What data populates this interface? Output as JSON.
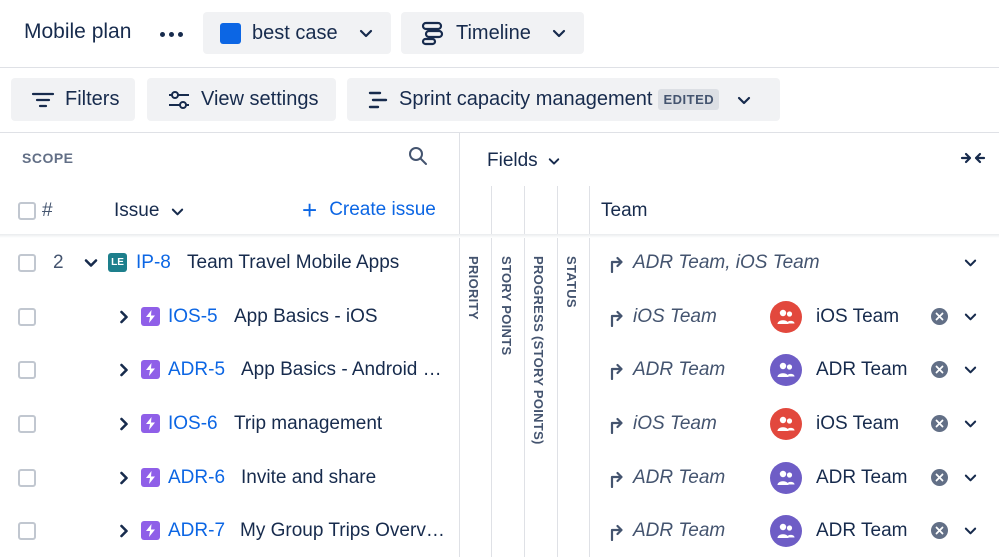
{
  "header": {
    "plan_title": "Mobile plan",
    "scenario": {
      "label": "best case",
      "color": "#0c66e4"
    },
    "view": {
      "label": "Timeline"
    }
  },
  "toolbar": {
    "filters_label": "Filters",
    "view_settings_label": "View settings",
    "capacity_label": "Sprint capacity management",
    "capacity_badge": "EDITED"
  },
  "scope": {
    "title": "SCOPE",
    "columns": {
      "hash": "#",
      "issue": "Issue",
      "create": "Create issue"
    }
  },
  "fields": {
    "label": "Fields",
    "columns": [
      "PRIORITY",
      "STORY POINTS",
      "PROGRESS (STORY POINTS)",
      "STATUS"
    ],
    "team_header": "Team"
  },
  "colors": {
    "ios_team": "#e2483d",
    "adr_team": "#6e5dc6",
    "epic": "#1d7f8c",
    "story": "#8f5fe8",
    "link": "#0c66e4"
  },
  "rows": [
    {
      "rank": "2",
      "icon_text": "LE",
      "type": "epic",
      "key": "IP-8",
      "title": "Team Travel Mobile Apps",
      "rollup": "ADR Team, iOS Team",
      "team": ""
    },
    {
      "rank": "",
      "icon_text": "",
      "type": "story",
      "key": "IOS-5",
      "title": "App Basics - iOS",
      "rollup": "iOS Team",
      "team": "iOS Team"
    },
    {
      "rank": "",
      "icon_text": "",
      "type": "story",
      "key": "ADR-5",
      "title": "App Basics - Android …",
      "rollup": "ADR Team",
      "team": "ADR Team"
    },
    {
      "rank": "",
      "icon_text": "",
      "type": "story",
      "key": "IOS-6",
      "title": "Trip management",
      "rollup": "iOS Team",
      "team": "iOS Team"
    },
    {
      "rank": "",
      "icon_text": "",
      "type": "story",
      "key": "ADR-6",
      "title": "Invite and share",
      "rollup": "ADR Team",
      "team": "ADR Team"
    },
    {
      "rank": "",
      "icon_text": "",
      "type": "story",
      "key": "ADR-7",
      "title": "My Group Trips Overv…",
      "rollup": "ADR Team",
      "team": "ADR Team"
    }
  ]
}
